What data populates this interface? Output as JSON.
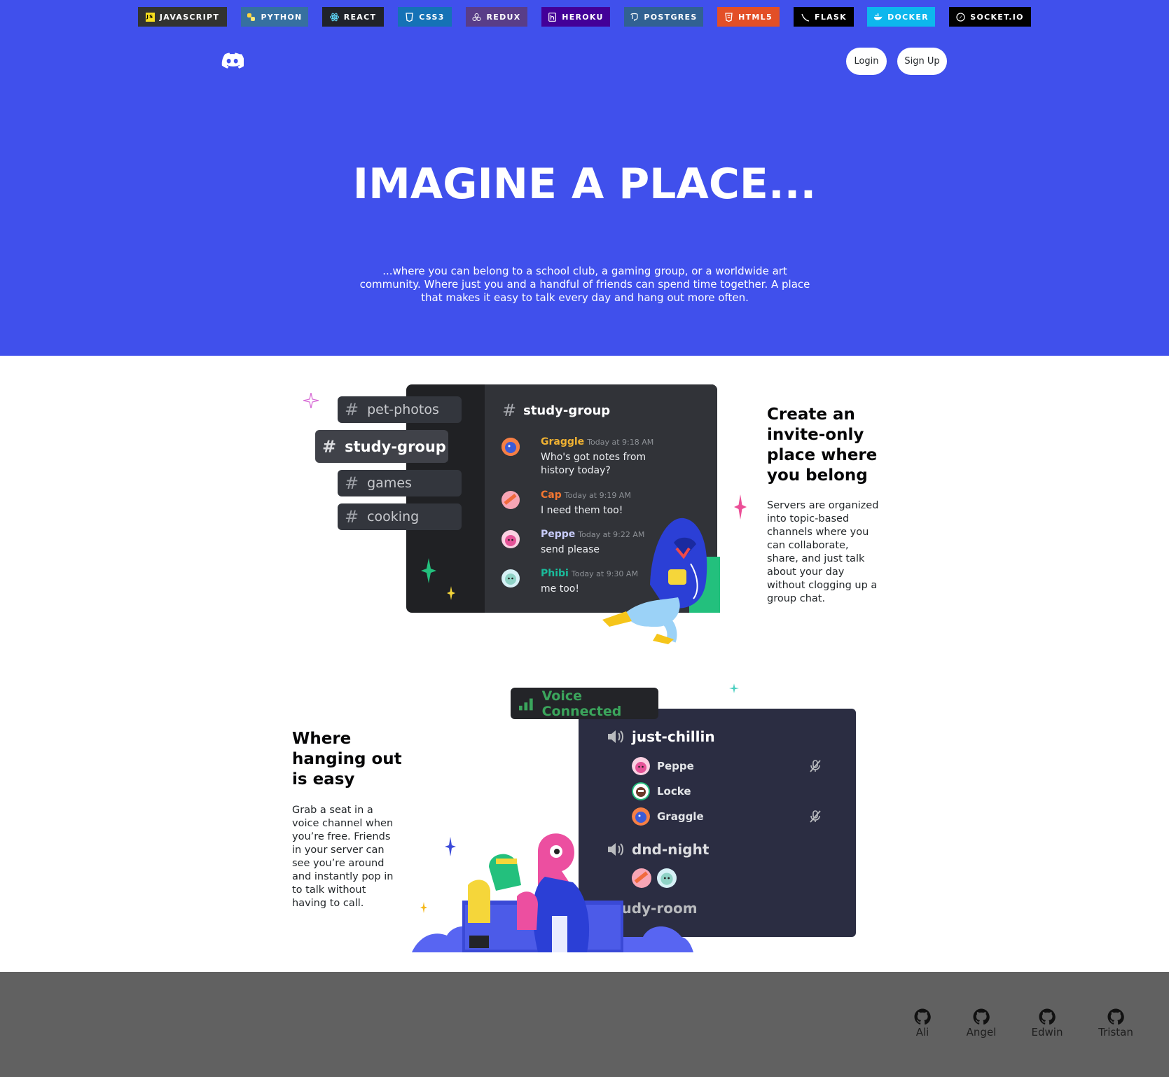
{
  "tech_badges": [
    {
      "label": "JAVASCRIPT",
      "bg": "#323330",
      "icon": "js-icon"
    },
    {
      "label": "PYTHON",
      "bg": "#3670a0",
      "icon": "python-icon"
    },
    {
      "label": "REACT",
      "bg": "#20232a",
      "icon": "react-icon"
    },
    {
      "label": "CSS3",
      "bg": "#1572b6",
      "icon": "css3-icon"
    },
    {
      "label": "REDUX",
      "bg": "#593d88",
      "icon": "redux-icon"
    },
    {
      "label": "HEROKU",
      "bg": "#430098",
      "icon": "heroku-icon"
    },
    {
      "label": "POSTGRES",
      "bg": "#316192",
      "icon": "postgres-icon"
    },
    {
      "label": "HTML5",
      "bg": "#e34f26",
      "icon": "html5-icon"
    },
    {
      "label": "FLASK",
      "bg": "#000000",
      "icon": "flask-icon"
    },
    {
      "label": "DOCKER",
      "bg": "#0db7ed",
      "icon": "docker-icon"
    },
    {
      "label": "SOCKET.IO",
      "bg": "#010101",
      "icon": "socketio-icon"
    }
  ],
  "nav": {
    "login_label": "Login",
    "signup_label": "Sign Up"
  },
  "hero": {
    "headline": "IMAGINE A PLACE...",
    "subtext": "...where you can belong to a school club, a gaming group, or a worldwide art community. Where just you and a handful of friends can spend time together. A place that makes it easy to talk every day and hang out more often."
  },
  "feature1": {
    "title": "Create an invite-only place where you belong",
    "body": "Servers are organized into topic-based channels where you can collaborate, share, and just talk about your day without clogging up a group chat.",
    "channels": [
      "pet-photos",
      "study-group",
      "games",
      "cooking"
    ],
    "active_channel": "study-group",
    "chat_title": "study-group",
    "messages": [
      {
        "name": "Graggle",
        "time": "Today at 9:18 AM",
        "text": "Who's got notes from history today?",
        "color": "#f0b232"
      },
      {
        "name": "Cap",
        "time": "Today at 9:19 AM",
        "text": "I need them too!",
        "color": "#f57731"
      },
      {
        "name": "Peppe",
        "time": "Today at 9:22 AM",
        "text": "send please",
        "color": "#c9cdfb"
      },
      {
        "name": "Phibi",
        "time": "Today at 9:30 AM",
        "text": "me too!",
        "color": "#1abc9c"
      }
    ]
  },
  "feature2": {
    "title": "Where hanging out is easy",
    "body": "Grab a seat in a voice channel when you’re free. Friends in your server can see you’re around and instantly pop in to talk without having to call.",
    "voice_status": "Voice Connected",
    "voice_channels": [
      {
        "name": "just-chillin",
        "users": [
          {
            "name": "Peppe",
            "muted": true
          },
          {
            "name": "Locke",
            "muted": false
          },
          {
            "name": "Graggle",
            "muted": true
          }
        ]
      },
      {
        "name": "dnd-night"
      },
      {
        "name": "study-room"
      }
    ]
  },
  "footer": {
    "developers": [
      "Ali",
      "Angel",
      "Edwin",
      "Tristan"
    ]
  },
  "colors": {
    "brand": "#4050ec",
    "footer": "#616161",
    "online": "#3ba55c"
  }
}
